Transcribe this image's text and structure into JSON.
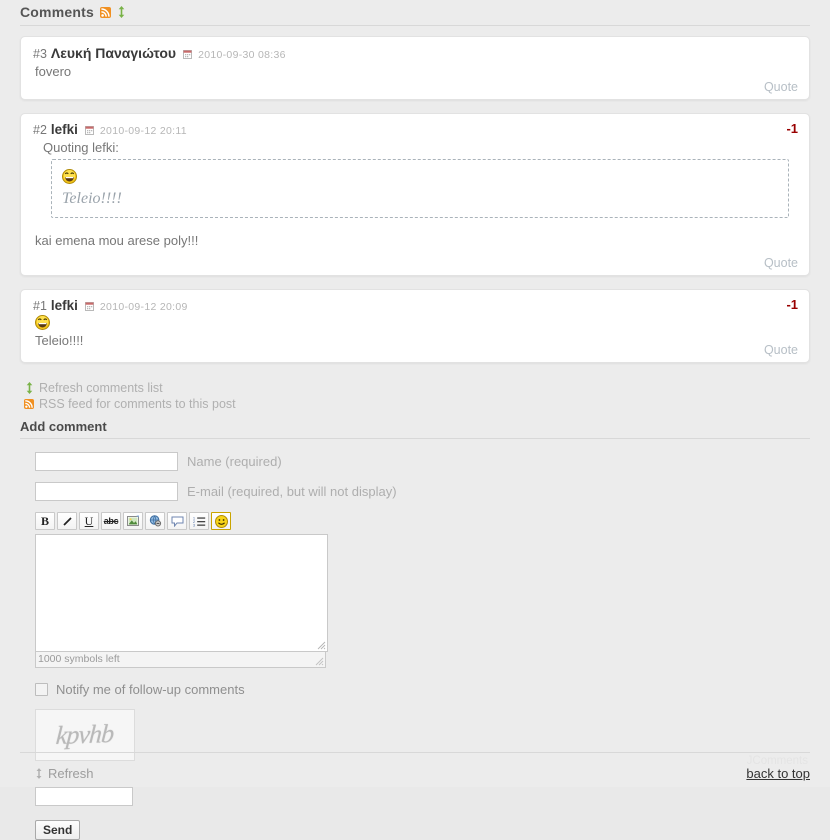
{
  "header": {
    "title": "Comments",
    "rss_icon": "rss-icon",
    "refresh_icon": "refresh-icon"
  },
  "comments": [
    {
      "number": "#3",
      "author": "Λευκή Παναγιώτου",
      "date": "2010-09-30 08:36",
      "body": "fovero",
      "vote": "",
      "quote_label": "Quote",
      "has_quote_block": false,
      "has_smiley": false
    },
    {
      "number": "#2",
      "author": "lefki",
      "date": "2010-09-12 20:11",
      "quoting_label": "Quoting lefki:",
      "quoted_text": "Teleio!!!!",
      "body": "kai emena mou arese poly!!!",
      "vote": "-1",
      "quote_label": "Quote",
      "has_quote_block": true,
      "has_smiley": true
    },
    {
      "number": "#1",
      "author": "lefki",
      "date": "2010-09-12 20:09",
      "body": "Teleio!!!!",
      "vote": "-1",
      "quote_label": "Quote",
      "has_quote_block": false,
      "has_smiley": true
    }
  ],
  "links": {
    "refresh_list": "Refresh comments list",
    "rss_feed": "RSS feed for comments to this post"
  },
  "add_comment": {
    "heading": "Add comment",
    "name_value": "",
    "name_label": "Name (required)",
    "email_value": "",
    "email_label": "E-mail (required, but will not display)",
    "toolbar": [
      {
        "name": "bold-button",
        "label": "B"
      },
      {
        "name": "italic-button",
        "label": "/"
      },
      {
        "name": "underline-button",
        "label": "U"
      },
      {
        "name": "strikethrough-button",
        "label": "abc"
      },
      {
        "name": "insert-image-button",
        "label": ""
      },
      {
        "name": "insert-link-button",
        "label": ""
      },
      {
        "name": "insert-quote-button",
        "label": ""
      },
      {
        "name": "ordered-list-button",
        "label": ""
      },
      {
        "name": "insert-smiley-button",
        "label": ""
      }
    ],
    "message_value": "",
    "symbols_left": "1000 symbols left",
    "notify_label": "Notify me of follow-up comments",
    "notify_checked": false,
    "captcha_text": "kpvhb",
    "captcha_refresh": "Refresh",
    "captcha_input_value": "",
    "send_label": "Send"
  },
  "footer": {
    "watermark": "JComments",
    "back_to_top": "back to top"
  },
  "colors": {
    "rss_orange": "#f09022",
    "refresh_green": "#7cb342",
    "vote_red": "#990000",
    "page_bg": "#ececec",
    "comment_bg": "#ffffff"
  }
}
